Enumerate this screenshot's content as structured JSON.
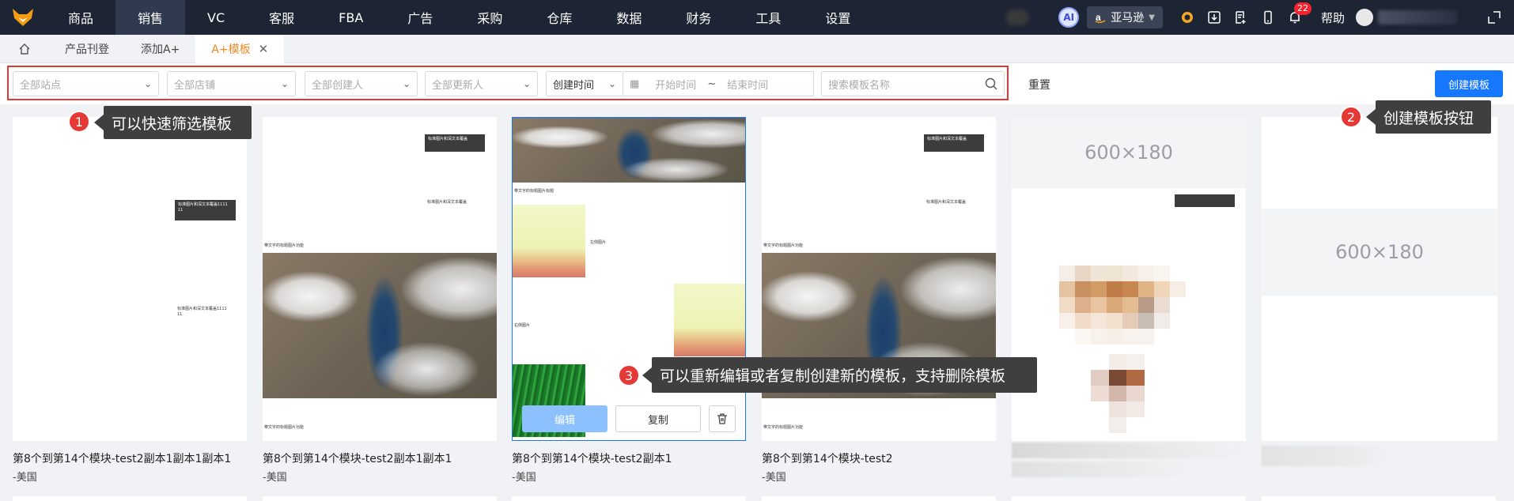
{
  "nav": {
    "menu": [
      "商品",
      "销售",
      "VC",
      "客服",
      "FBA",
      "广告",
      "采购",
      "仓库",
      "数据",
      "财务",
      "工具",
      "设置"
    ],
    "active_index": 1,
    "ai_label": "AI",
    "platform": "亚马逊",
    "notification_count": "22",
    "help_label": "帮助"
  },
  "tabs": {
    "items": [
      "产品刊登",
      "添加A+",
      "A+模板"
    ],
    "active_index": 2
  },
  "filters": {
    "site": "全部站点",
    "shop": "全部店铺",
    "creator": "全部创建人",
    "updater": "全部更新人",
    "time_type": "创建时间",
    "start_date": "开始时间",
    "date_sep": "~",
    "end_date": "结束时间",
    "search_placeholder": "搜索模板名称",
    "reset_label": "重置",
    "create_label": "创建模板"
  },
  "cards": [
    {
      "title": "第8个到第14个模块-test2副本1副本1副本1",
      "sub": "-美国"
    },
    {
      "title": "第8个到第14个模块-test2副本1副本1",
      "sub": "-美国"
    },
    {
      "title": "第8个到第14个模块-test2副本1",
      "sub": "-美国"
    },
    {
      "title": "第8个到第14个模块-test2",
      "sub": "-美国"
    }
  ],
  "card_actions": {
    "edit": "编辑",
    "copy": "复制"
  },
  "placeholder_label": "600×180",
  "annotations": [
    {
      "num": "1",
      "text": "可以快速筛选模板"
    },
    {
      "num": "2",
      "text": "创建模板按钮"
    },
    {
      "num": "3",
      "text": "可以重新编辑或者复制创建新的模板，支持删除模板"
    }
  ],
  "colors": {
    "accent": "#1677ff",
    "nav_bg": "#1d2433",
    "tab_active": "#f08a24",
    "highlight": "#e53935"
  }
}
